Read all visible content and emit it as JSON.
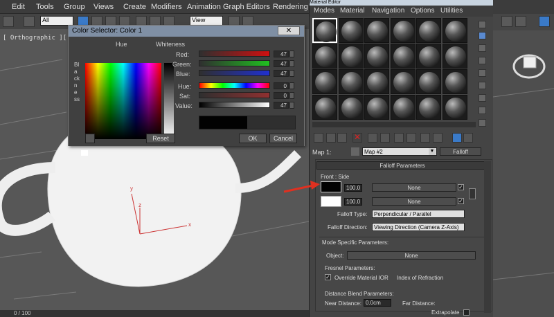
{
  "menubar": {
    "items": [
      "Edit",
      "Tools",
      "Group",
      "Views",
      "Create",
      "Modifiers",
      "Animation",
      "Graph Editors",
      "Rendering"
    ]
  },
  "toolbar": {
    "selection_filter": "All",
    "coord_system": "View"
  },
  "viewport": {
    "label": "[ Orthographic ][ Realis",
    "axis_x": "x",
    "axis_y": "y",
    "axis_z": "z"
  },
  "status": {
    "frame": "0 / 100"
  },
  "color_selector": {
    "title": "Color Selector: Color 1",
    "close": "✕",
    "hue_label": "Hue",
    "whiteness_label": "Whiteness",
    "blackness_label": "Blackness",
    "channels": [
      {
        "label": "Red:",
        "value": "47",
        "color": "#c01010"
      },
      {
        "label": "Green:",
        "value": "47",
        "color": "#10b010"
      },
      {
        "label": "Blue:",
        "value": "47",
        "color": "#2030c0"
      },
      {
        "label": "Hue:",
        "value": "0",
        "color": "hue"
      },
      {
        "label": "Sat:",
        "value": "0",
        "color": "#a03030"
      },
      {
        "label": "Value:",
        "value": "47",
        "color": "#ffffff"
      }
    ],
    "reset": "Reset",
    "ok": "OK",
    "cancel": "Cancel"
  },
  "material_editor": {
    "title": "Material Editor",
    "menu": [
      "Modes",
      "Material",
      "Navigation",
      "Options",
      "Utilities"
    ],
    "map_label": "Map 1:",
    "map_name": "Map #2",
    "map_type": "Falloff",
    "falloff_rollout": "Falloff Parameters",
    "front_side": "Front : Side",
    "color1_amount": "100.0",
    "color2_amount": "100.0",
    "none1": "None",
    "none2": "None",
    "falloff_type_label": "Falloff Type:",
    "falloff_type": "Perpendicular / Parallel",
    "falloff_direction_label": "Falloff Direction:",
    "falloff_direction": "Viewing Direction (Camera Z-Axis)",
    "mode_specific": "Mode Specific Parameters:",
    "object_label": "Object:",
    "object_value": "None",
    "fresnel_label": "Fresnel Parameters:",
    "override_ior": "Override Material IOR",
    "index_label": "Index of Refraction",
    "distance_blend": "Distance Blend Parameters:",
    "near_label": "Near Distance:",
    "near_value": "0.0cm",
    "far_label": "Far Distance:",
    "extrapolate": "Extrapolate"
  }
}
